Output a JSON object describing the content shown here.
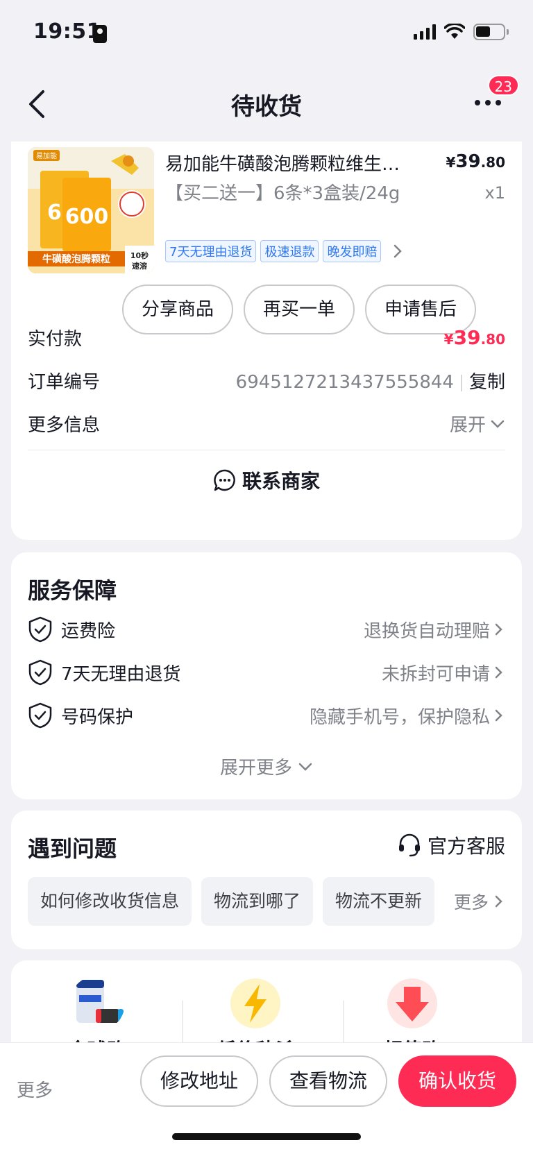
{
  "status": {
    "time": "19:51"
  },
  "nav": {
    "title": "待收货",
    "badge": "23"
  },
  "product": {
    "title": "易加能牛磺酸泡腾颗粒维生素...",
    "price_symbol": "¥",
    "price_int": "39",
    "price_dec": ".80",
    "spec": "【买二送一】6条*3盒装/24g",
    "qty": "x1",
    "tags": [
      "7天无理由退货",
      "极速退款",
      "晚发即赔"
    ],
    "image_text": {
      "brand": "易加能",
      "number": "600",
      "banner": "牛磺酸泡腾颗粒",
      "badge": "10秒速溶"
    }
  },
  "actions": {
    "share": "分享商品",
    "rebuy": "再买一单",
    "after_sale": "申请售后"
  },
  "payment": {
    "label": "实付款",
    "symbol": "¥",
    "int": "39",
    "dec": ".80"
  },
  "order": {
    "label": "订单编号",
    "number": "6945127213437555844",
    "copy": "复制"
  },
  "more_info": {
    "label": "更多信息",
    "expand": "展开"
  },
  "contact": {
    "label": "联系商家"
  },
  "service": {
    "title": "服务保障",
    "items": [
      {
        "name": "运费险",
        "desc": "退换货自动理赔"
      },
      {
        "name": "7天无理由退货",
        "desc": "未拆封可申请"
      },
      {
        "name": "号码保护",
        "desc": "隐藏手机号，保护隐私"
      }
    ],
    "more": "展开更多"
  },
  "problem": {
    "title": "遇到问题",
    "cs": "官方客服",
    "chips": [
      "如何修改收货信息",
      "物流到哪了",
      "物流不更新"
    ],
    "more": "更多"
  },
  "promo": {
    "items": [
      "全球购",
      "低价秒杀",
      "超值购"
    ]
  },
  "bottom": {
    "more": "更多",
    "edit_address": "修改地址",
    "logistics": "查看物流",
    "confirm": "确认收货"
  },
  "colors": {
    "accent": "#fe2c55",
    "tag_blue": "#2f78f2",
    "text_gray": "#80828a"
  }
}
